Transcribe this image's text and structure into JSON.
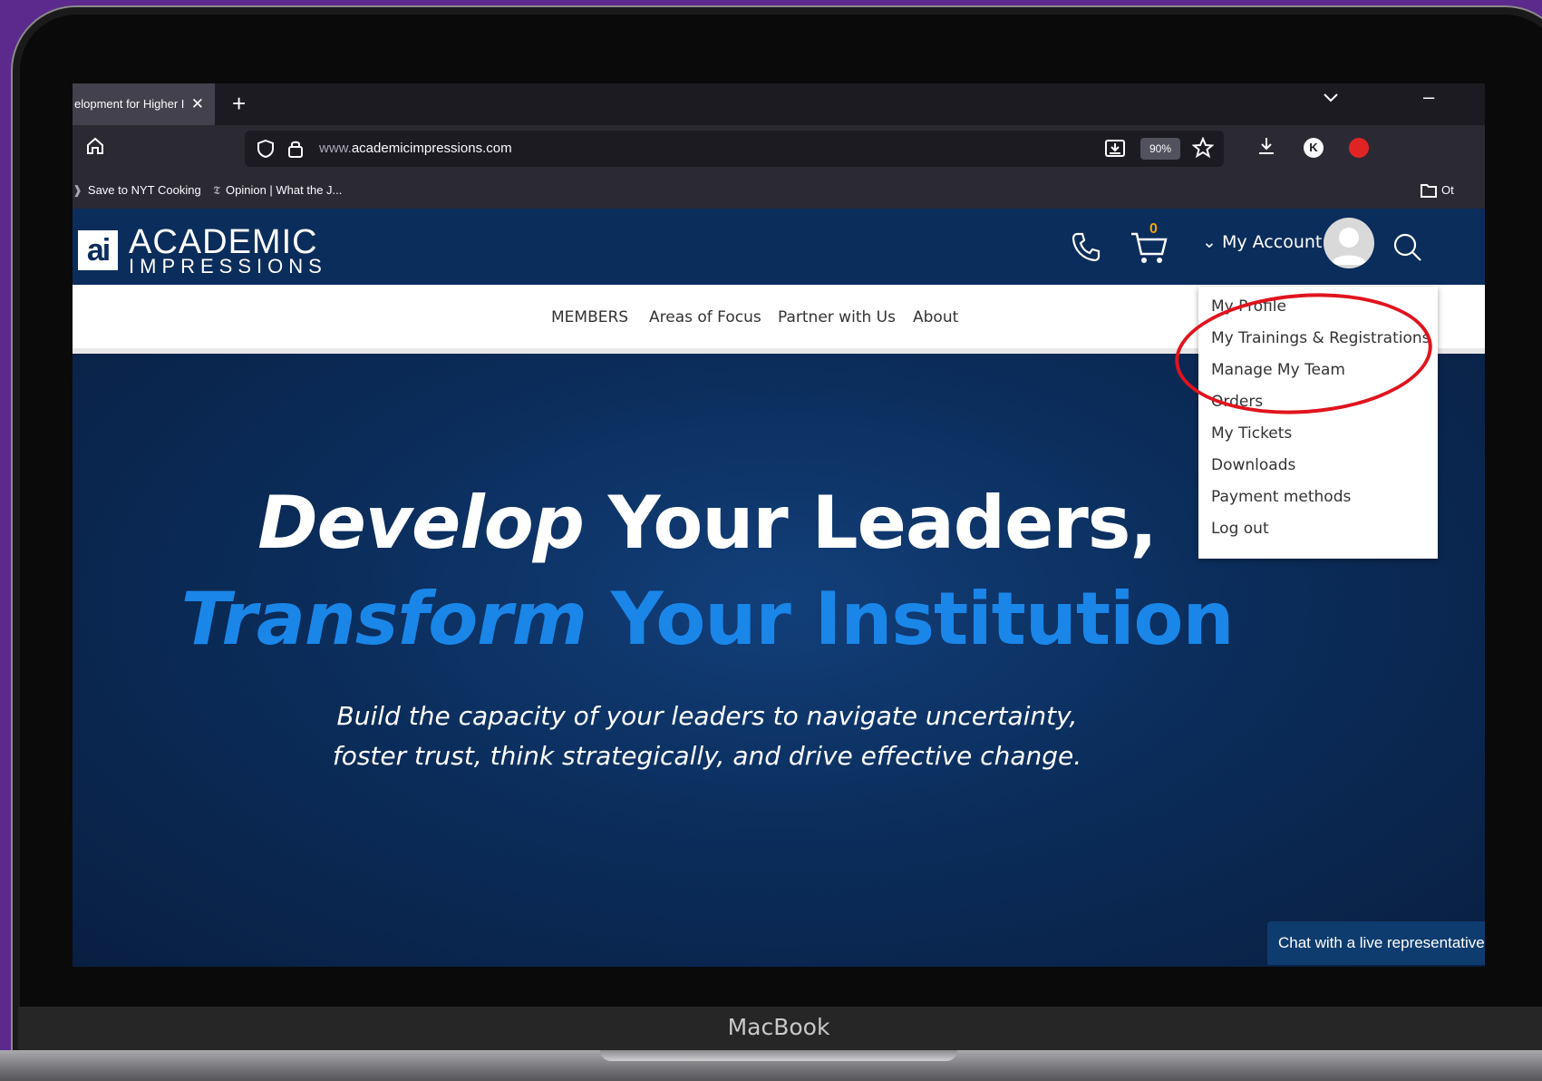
{
  "device": {
    "label": "MacBook"
  },
  "browser": {
    "tab": {
      "title": "elopment for Higher I",
      "close": "✕"
    },
    "new_tab": "+",
    "url": {
      "prefix": "www.",
      "domain": "academicimpressions.com"
    },
    "zoom": "90%",
    "profile_initial": "K",
    "bookmarks": [
      {
        "label": "Save to NYT Cooking"
      },
      {
        "label": "Opinion | What the J..."
      }
    ],
    "other_bookmarks": "Ot"
  },
  "site": {
    "logo": {
      "mark": "ai",
      "line1": "ACADEMIC",
      "line2": "IMPRESSIONS"
    },
    "cart_count": "0",
    "my_account": "My Account",
    "nav": [
      "MEMBERS",
      "Areas of Focus",
      "Partner with Us",
      "About"
    ],
    "account_menu": [
      "My Profile",
      "My Trainings & Registrations",
      "Manage My Team",
      "Orders",
      "My Tickets",
      "Downloads",
      "Payment methods",
      "Log out"
    ],
    "hero": {
      "line1_emphasis": "Develop",
      "line1_rest": "Your Leaders,",
      "line2_emphasis": "Transform",
      "line2_rest": "Your Institution",
      "sub1": "Build the capacity of your leaders to navigate uncertainty,",
      "sub2": "foster trust, think strategically, and drive effective change."
    },
    "chat": "Chat with a live representative"
  },
  "annotation": {
    "color": "#e0141e"
  },
  "icons": [
    "home-icon",
    "shield-icon",
    "lock-icon",
    "save-page-icon",
    "star-icon",
    "download-icon",
    "phone-icon",
    "cart-icon",
    "user-icon",
    "search-icon",
    "chevron-down-icon",
    "folder-icon"
  ]
}
